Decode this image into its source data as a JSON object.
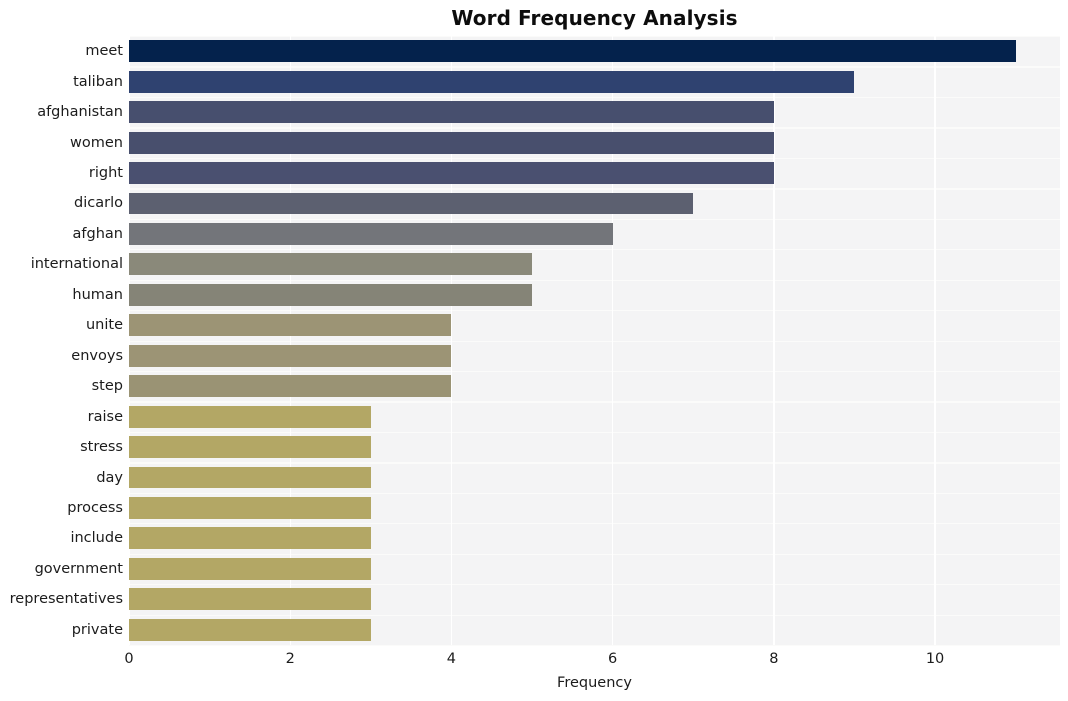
{
  "chart_data": {
    "type": "bar",
    "orientation": "horizontal",
    "title": "Word Frequency Analysis",
    "xlabel": "Frequency",
    "ylabel": "",
    "xlim": [
      0,
      11.55
    ],
    "xticks": [
      0,
      2,
      4,
      6,
      8,
      10
    ],
    "xtick_labels": [
      "0",
      "2",
      "4",
      "6",
      "8",
      "10"
    ],
    "grid": true,
    "legend": false,
    "categories": [
      "meet",
      "taliban",
      "afghanistan",
      "women",
      "right",
      "dicarlo",
      "afghan",
      "international",
      "human",
      "unite",
      "envoys",
      "step",
      "raise",
      "stress",
      "day",
      "process",
      "include",
      "government",
      "representatives",
      "private"
    ],
    "values": [
      11,
      9,
      8,
      8,
      8,
      7,
      6,
      5,
      5,
      4,
      4,
      4,
      3,
      3,
      3,
      3,
      3,
      3,
      3,
      3
    ],
    "bar_colors": [
      "#04224c",
      "#2f4270",
      "#474f6e",
      "#484f6d",
      "#4a5070",
      "#5c6070",
      "#73757a",
      "#8a897a",
      "#858477",
      "#9c9475",
      "#9c9475",
      "#9a9374",
      "#b3a765",
      "#b3a765",
      "#b3a765",
      "#b3a765",
      "#b3a765",
      "#b3a765",
      "#b3a765",
      "#b3a765"
    ],
    "plot_background": "#f4f4f5",
    "grid_color": "#ffffff",
    "figure_background": "#ffffff",
    "title_color": "#0d0d0d",
    "tick_color": "#1c1c1c"
  }
}
